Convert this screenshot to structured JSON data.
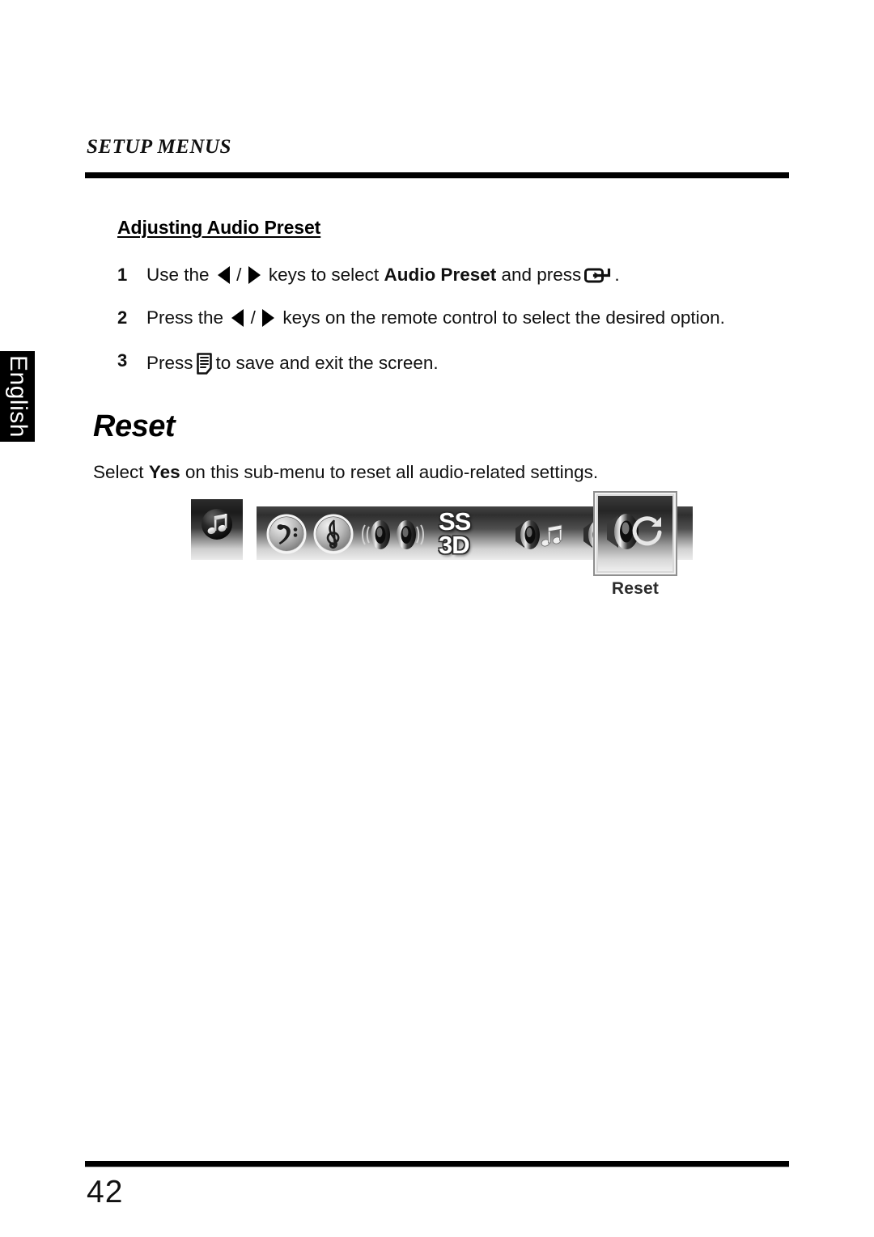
{
  "page": {
    "running_head": "SETUP MENUS",
    "page_number": "42",
    "language_tab": "English"
  },
  "sections": {
    "adjusting": {
      "heading": "Adjusting Audio Preset",
      "steps": [
        {
          "number": "1",
          "text_before": "Use the",
          "icon_left": "triangle-left-icon",
          "separator": "/",
          "icon_right": "triangle-right-icon",
          "text_middle": "keys to select",
          "bold_term": "Audio Preset",
          "text_after": "and press",
          "icon_end": "enter-key-icon",
          "text_end": "."
        },
        {
          "number": "2",
          "text_before": "Press the",
          "icon_left": "triangle-left-icon",
          "separator": "/",
          "icon_right": "triangle-right-icon",
          "text_middle": "keys on the remote control to select the desired option.",
          "bold_term": "",
          "text_after": "",
          "icon_end": "",
          "text_end": ""
        },
        {
          "number": "3",
          "text_before": "Press",
          "icon_left": "",
          "separator": "",
          "icon_right": "",
          "text_middle": "",
          "bold_term": "",
          "text_after": "",
          "icon_end": "menu-key-icon",
          "text_end": "to save and exit the screen."
        }
      ]
    },
    "reset": {
      "title": "Reset",
      "description_before": "Select",
      "description_bold": "Yes",
      "description_after": "on this sub-menu to reset all audio-related settings."
    }
  },
  "osd_figure": {
    "badge_icon": "music-note-icon",
    "bar_items": [
      {
        "icon": "bass-clef-icon",
        "label": ""
      },
      {
        "icon": "treble-clef-icon",
        "label": ""
      },
      {
        "icon": "dual-speakers-icon",
        "label": ""
      },
      {
        "icon": "ss-3d-logo",
        "label": "SS 3D",
        "line1": "SS",
        "line2": "3D"
      },
      {
        "icon": "speaker-music-icon",
        "label": ""
      },
      {
        "icon": "speaker-sparkle-icon",
        "label": ""
      }
    ],
    "selected_item": {
      "icon": "speaker-reset-icon",
      "label": "Reset"
    }
  },
  "colors": {
    "rule": "#000000",
    "tab_background": "#000000",
    "tab_text": "#ffffff",
    "caption_text": "#2b2b2b",
    "body_text": "#111111"
  }
}
